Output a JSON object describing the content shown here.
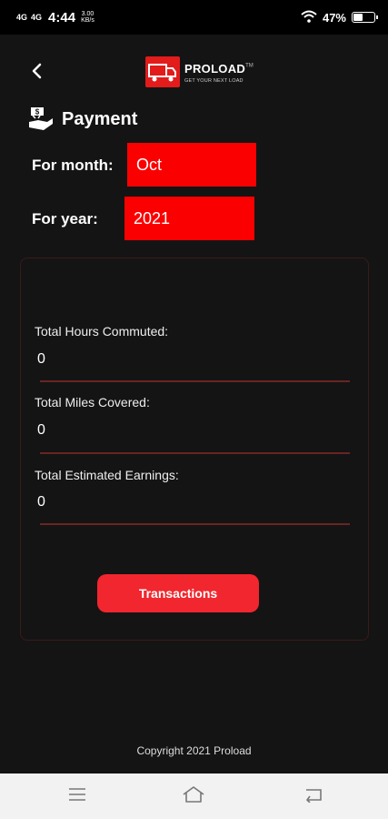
{
  "status_bar": {
    "signal_1": "4G",
    "signal_2": "4G",
    "time": "4:44",
    "speed_value": "3.00",
    "speed_unit": "KB/s",
    "battery": "47%",
    "battery_level": 0.47
  },
  "header": {
    "brand": "PROLOAD",
    "trademark": "TM",
    "tagline": "GET YOUR NEXT LOAD",
    "brand_color": "#e21b1b"
  },
  "payment": {
    "title": "Payment",
    "month_label": "For month:",
    "month_value": "Oct",
    "year_label": "For year:",
    "year_value": "2021",
    "accent": "#fb0000"
  },
  "stats": {
    "hours_label": "Total Hours Commuted:",
    "hours_value": "0",
    "miles_label": "Total Miles Covered:",
    "miles_value": "0",
    "earnings_label": "Total Estimated Earnings:",
    "earnings_value": "0"
  },
  "actions": {
    "transactions_label": "Transactions"
  },
  "footer": {
    "copyright": "Copyright 2021 Proload"
  },
  "icons": [
    "back-arrow-icon",
    "money-hand-icon",
    "wifi-icon",
    "battery-icon",
    "menu-icon",
    "home-icon",
    "back-nav-icon"
  ]
}
